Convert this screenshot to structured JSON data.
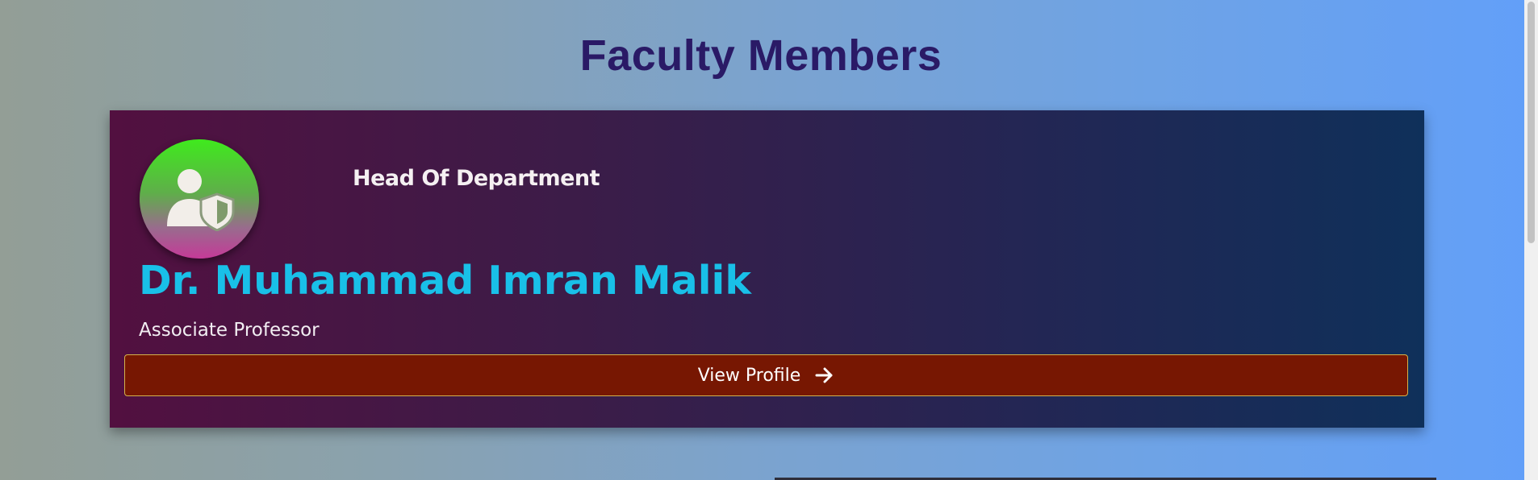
{
  "page": {
    "title": "Faculty Members"
  },
  "faculty_card": {
    "role": "Head Of Department",
    "name": "Dr. Muhammad Imran Malik",
    "designation": "Associate Professor",
    "button_label": "View Profile",
    "avatar_icon": "user-shield-icon",
    "button_icon": "arrow-right-icon"
  },
  "colors": {
    "title": "#2a1a66",
    "name": "#19c0e8",
    "button_background": "#771702",
    "button_border": "#d4b24a"
  }
}
